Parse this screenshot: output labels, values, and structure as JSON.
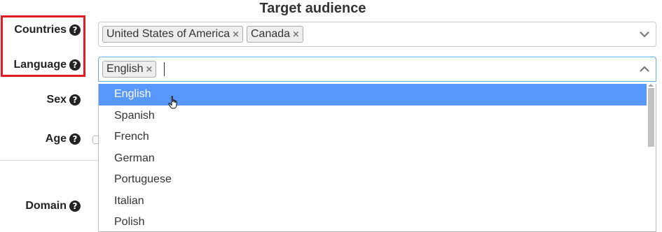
{
  "section": {
    "title": "Target audience"
  },
  "labels": {
    "countries": "Countries",
    "language": "Language",
    "sex": "Sex",
    "age": "Age",
    "domain": "Domain"
  },
  "help_icon_glyph": "?",
  "countries_field": {
    "tags": [
      {
        "label": "United States of America",
        "remove": "×"
      },
      {
        "label": "Canada",
        "remove": "×"
      }
    ]
  },
  "language_field": {
    "tags": [
      {
        "label": "English",
        "remove": "×"
      }
    ]
  },
  "language_options": [
    "English",
    "Spanish",
    "French",
    "German",
    "Portuguese",
    "Italian",
    "Polish"
  ],
  "highlighted_option": "English",
  "colors": {
    "highlight": "#5897fb",
    "annotation_box": "#e31b23"
  }
}
